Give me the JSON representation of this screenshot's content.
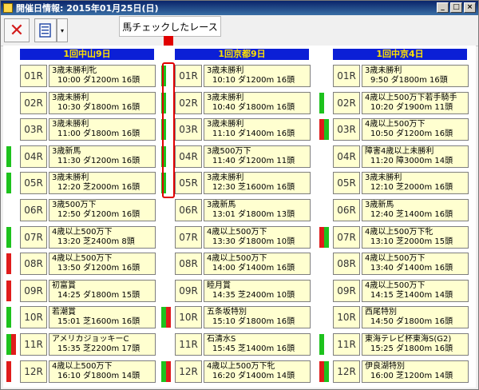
{
  "window": {
    "title": "開催日情報: 2015年01月25日(日)",
    "buttons": {
      "minimize": "_",
      "maximize": "□",
      "close": "×"
    }
  },
  "toolbar": {
    "close_icon": "close-icon",
    "list_icon": "list-icon",
    "dropdown": "▾"
  },
  "annotation": {
    "text": "馬チェックしたレース"
  },
  "colors": {
    "green": "#1dc21d",
    "red": "#e01b1b",
    "header_bg": "#0b1fd6",
    "header_text": "#ffe100",
    "cell_bg": "#ffffd0"
  },
  "venues": [
    {
      "name": "1回中山9日",
      "races": [
        {
          "no": "01R",
          "name": "3歳未勝利牝",
          "detail": "10:00 ダ1200m 16頭",
          "marks": [
            "",
            ""
          ]
        },
        {
          "no": "02R",
          "name": "3歳未勝利",
          "detail": "10:30 ダ1800m 16頭",
          "marks": [
            "",
            ""
          ]
        },
        {
          "no": "03R",
          "name": "3歳未勝利",
          "detail": "11:00 ダ1800m 16頭",
          "marks": [
            "",
            ""
          ]
        },
        {
          "no": "04R",
          "name": "3歳新馬",
          "detail": "11:30 ダ1200m 16頭",
          "marks": [
            "green",
            ""
          ]
        },
        {
          "no": "05R",
          "name": "3歳未勝利",
          "detail": "12:20 芝2000m 16頭",
          "marks": [
            "green",
            ""
          ]
        },
        {
          "no": "06R",
          "name": "3歳500万下",
          "detail": "12:50 ダ1200m 16頭",
          "marks": [
            "",
            ""
          ]
        },
        {
          "no": "07R",
          "name": "4歳以上500万下",
          "detail": "13:20 芝2400m 8頭",
          "marks": [
            "green",
            ""
          ]
        },
        {
          "no": "08R",
          "name": "4歳以上500万下",
          "detail": "13:50 ダ1200m 16頭",
          "marks": [
            "red",
            ""
          ]
        },
        {
          "no": "09R",
          "name": "初富賞",
          "detail": "14:25 ダ1800m 15頭",
          "marks": [
            "red",
            ""
          ]
        },
        {
          "no": "10R",
          "name": "若潮賞",
          "detail": "15:01 芝1600m 16頭",
          "marks": [
            "green",
            ""
          ]
        },
        {
          "no": "11R",
          "name": "アメリカジョッキーC",
          "detail": "15:35 芝2200m 17頭",
          "marks": [
            "green",
            "red"
          ]
        },
        {
          "no": "12R",
          "name": "4歳以上500万下",
          "detail": "16:10 ダ1800m 14頭",
          "marks": [
            "red",
            ""
          ]
        }
      ]
    },
    {
      "name": "1回京都9日",
      "races": [
        {
          "no": "01R",
          "name": "3歳未勝利",
          "detail": "10:10 ダ1200m 16頭",
          "marks": [
            "green",
            ""
          ]
        },
        {
          "no": "02R",
          "name": "3歳未勝利",
          "detail": "10:40 ダ1800m 16頭",
          "marks": [
            "green",
            ""
          ]
        },
        {
          "no": "03R",
          "name": "3歳未勝利",
          "detail": "11:10 ダ1400m 16頭",
          "marks": [
            "green",
            ""
          ]
        },
        {
          "no": "04R",
          "name": "3歳500万下",
          "detail": "11:40 ダ1200m 11頭",
          "marks": [
            "green",
            ""
          ]
        },
        {
          "no": "05R",
          "name": "3歳未勝利",
          "detail": "12:30 芝1600m 16頭",
          "marks": [
            "green",
            ""
          ]
        },
        {
          "no": "06R",
          "name": "3歳新馬",
          "detail": "13:01 ダ1800m 13頭",
          "marks": [
            "",
            ""
          ]
        },
        {
          "no": "07R",
          "name": "4歳以上500万下",
          "detail": "13:30 ダ1800m 10頭",
          "marks": [
            "",
            ""
          ]
        },
        {
          "no": "08R",
          "name": "4歳以上500万下",
          "detail": "14:00 ダ1400m 16頭",
          "marks": [
            "",
            ""
          ]
        },
        {
          "no": "09R",
          "name": "睦月賞",
          "detail": "14:35 芝2400m 10頭",
          "marks": [
            "",
            ""
          ]
        },
        {
          "no": "10R",
          "name": "五条坂特別",
          "detail": "15:10 ダ1800m 16頭",
          "marks": [
            "green",
            "red"
          ]
        },
        {
          "no": "11R",
          "name": "石清水S",
          "detail": "15:45 芝1400m 16頭",
          "marks": [
            "",
            ""
          ]
        },
        {
          "no": "12R",
          "name": "4歳以上500万下牝",
          "detail": "16:20 ダ1400m 14頭",
          "marks": [
            "green",
            "red"
          ]
        }
      ]
    },
    {
      "name": "1回中京4日",
      "races": [
        {
          "no": "01R",
          "name": "3歳未勝利",
          "detail": "9:50 ダ1800m 16頭",
          "marks": [
            "",
            ""
          ]
        },
        {
          "no": "02R",
          "name": "4歳以上500万下若手騎手",
          "detail": "10:20 ダ1900m 11頭",
          "marks": [
            "green",
            ""
          ]
        },
        {
          "no": "03R",
          "name": "4歳以上500万下",
          "detail": "10:50 ダ1200m 16頭",
          "marks": [
            "red",
            "green"
          ]
        },
        {
          "no": "04R",
          "name": "障害4歳以上未勝利",
          "detail": "11:20 障3000m 14頭",
          "marks": [
            "",
            ""
          ]
        },
        {
          "no": "05R",
          "name": "3歳未勝利",
          "detail": "12:10 芝2000m 16頭",
          "marks": [
            "",
            ""
          ]
        },
        {
          "no": "06R",
          "name": "3歳新馬",
          "detail": "12:40 芝1400m 16頭",
          "marks": [
            "",
            ""
          ]
        },
        {
          "no": "07R",
          "name": "4歳以上500万下牝",
          "detail": "13:10 芝2000m 15頭",
          "marks": [
            "red",
            "green"
          ]
        },
        {
          "no": "08R",
          "name": "4歳以上500万下",
          "detail": "13:40 ダ1400m 16頭",
          "marks": [
            "",
            ""
          ]
        },
        {
          "no": "09R",
          "name": "4歳以上500万下",
          "detail": "14:15 芝1400m 14頭",
          "marks": [
            "",
            ""
          ]
        },
        {
          "no": "10R",
          "name": "西尾特別",
          "detail": "14:50 ダ1800m 16頭",
          "marks": [
            "",
            ""
          ]
        },
        {
          "no": "11R",
          "name": "東海テレビ杯東海S(G2)",
          "detail": "15:25 ダ1800m 16頭",
          "marks": [
            "green",
            ""
          ]
        },
        {
          "no": "12R",
          "name": "伊良湖特別",
          "detail": "16:00 芝1200m 14頭",
          "marks": [
            "red",
            "green"
          ]
        }
      ]
    }
  ]
}
